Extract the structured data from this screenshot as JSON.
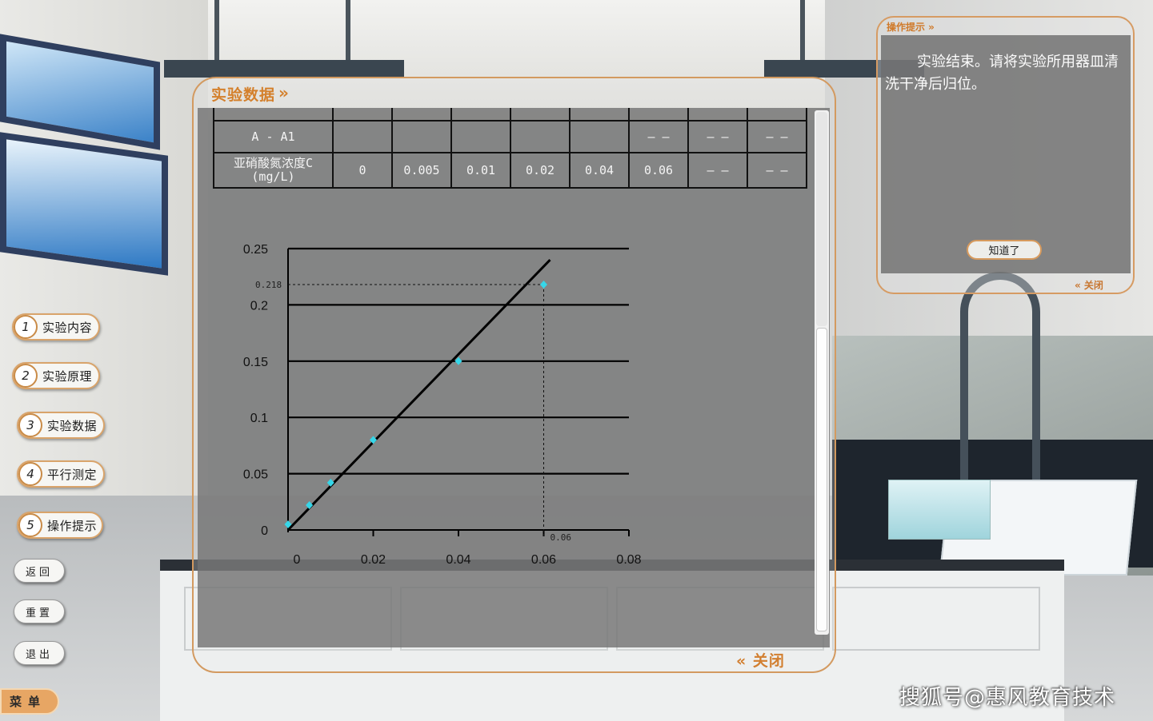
{
  "nav": {
    "items": [
      {
        "num": "1",
        "label": "实验内容"
      },
      {
        "num": "2",
        "label": "实验原理"
      },
      {
        "num": "3",
        "label": "实验数据"
      },
      {
        "num": "4",
        "label": "平行测定"
      },
      {
        "num": "5",
        "label": "操作提示"
      }
    ],
    "back": "返回",
    "reset": "重置",
    "exit": "退出",
    "menu": "菜单"
  },
  "panel": {
    "title": "实验数据",
    "title_arrow": "»",
    "close": "« 关闭"
  },
  "table": {
    "row1_label": "A - A1",
    "row1_cells": [
      "",
      "",
      "",
      "",
      "",
      "— —",
      "— —",
      "— —"
    ],
    "row2_label_line1": "亚硝酸氮浓度C",
    "row2_label_line2": "(mg/L)",
    "row2_cells": [
      "0",
      "0.005",
      "0.01",
      "0.02",
      "0.04",
      "0.06",
      "— —",
      "— —"
    ]
  },
  "chart_data": {
    "type": "scatter",
    "x_ticks": [
      "0",
      "0.02",
      "0.04",
      "0.06",
      "0.08"
    ],
    "y_ticks": [
      "0",
      "0.05",
      "0.1",
      "0.15",
      "0.2",
      "0.25"
    ],
    "xlim": [
      0,
      0.08
    ],
    "ylim": [
      0,
      0.25
    ],
    "grid": "horizontal",
    "points": [
      {
        "x": 0,
        "y": 0.005
      },
      {
        "x": 0.005,
        "y": 0.022
      },
      {
        "x": 0.01,
        "y": 0.042
      },
      {
        "x": 0.02,
        "y": 0.08
      },
      {
        "x": 0.04,
        "y": 0.15
      },
      {
        "x": 0.06,
        "y": 0.218
      }
    ],
    "fit_line": [
      {
        "x": 0,
        "y": 0.0
      },
      {
        "x": 0.0615,
        "y": 0.24
      }
    ],
    "annotation_x": "0.06",
    "annotation_y": "0.218",
    "marker_color": "#36d6e8",
    "line_color": "#000000"
  },
  "tips": {
    "title": "操作提示 »",
    "text": "实验结束。请将实验所用器皿清洗干净后归位。",
    "ok": "知道了",
    "close": "« 关闭"
  },
  "watermark": "搜狐号@惠风教育技术"
}
